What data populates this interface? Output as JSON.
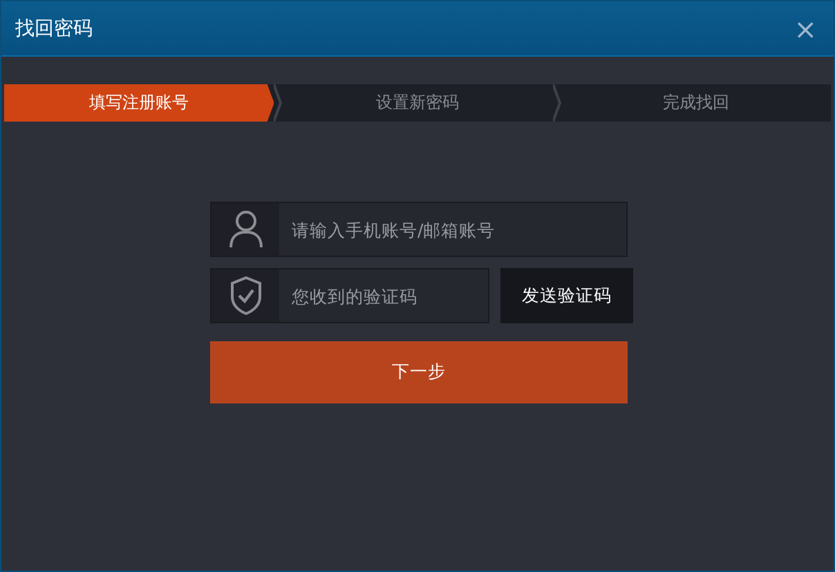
{
  "window": {
    "title": "找回密码",
    "close": "×"
  },
  "steps": [
    {
      "label": "填写注册账号",
      "selected": true
    },
    {
      "label": "设置新密码",
      "selected": false
    },
    {
      "label": "完成找回",
      "selected": false
    }
  ],
  "account_field": {
    "placeholder": "请输入手机账号/邮箱账号"
  },
  "code_field": {
    "placeholder": "您收到的验证码"
  },
  "send_code_button": "发送验证码",
  "next_button": "下一步"
}
